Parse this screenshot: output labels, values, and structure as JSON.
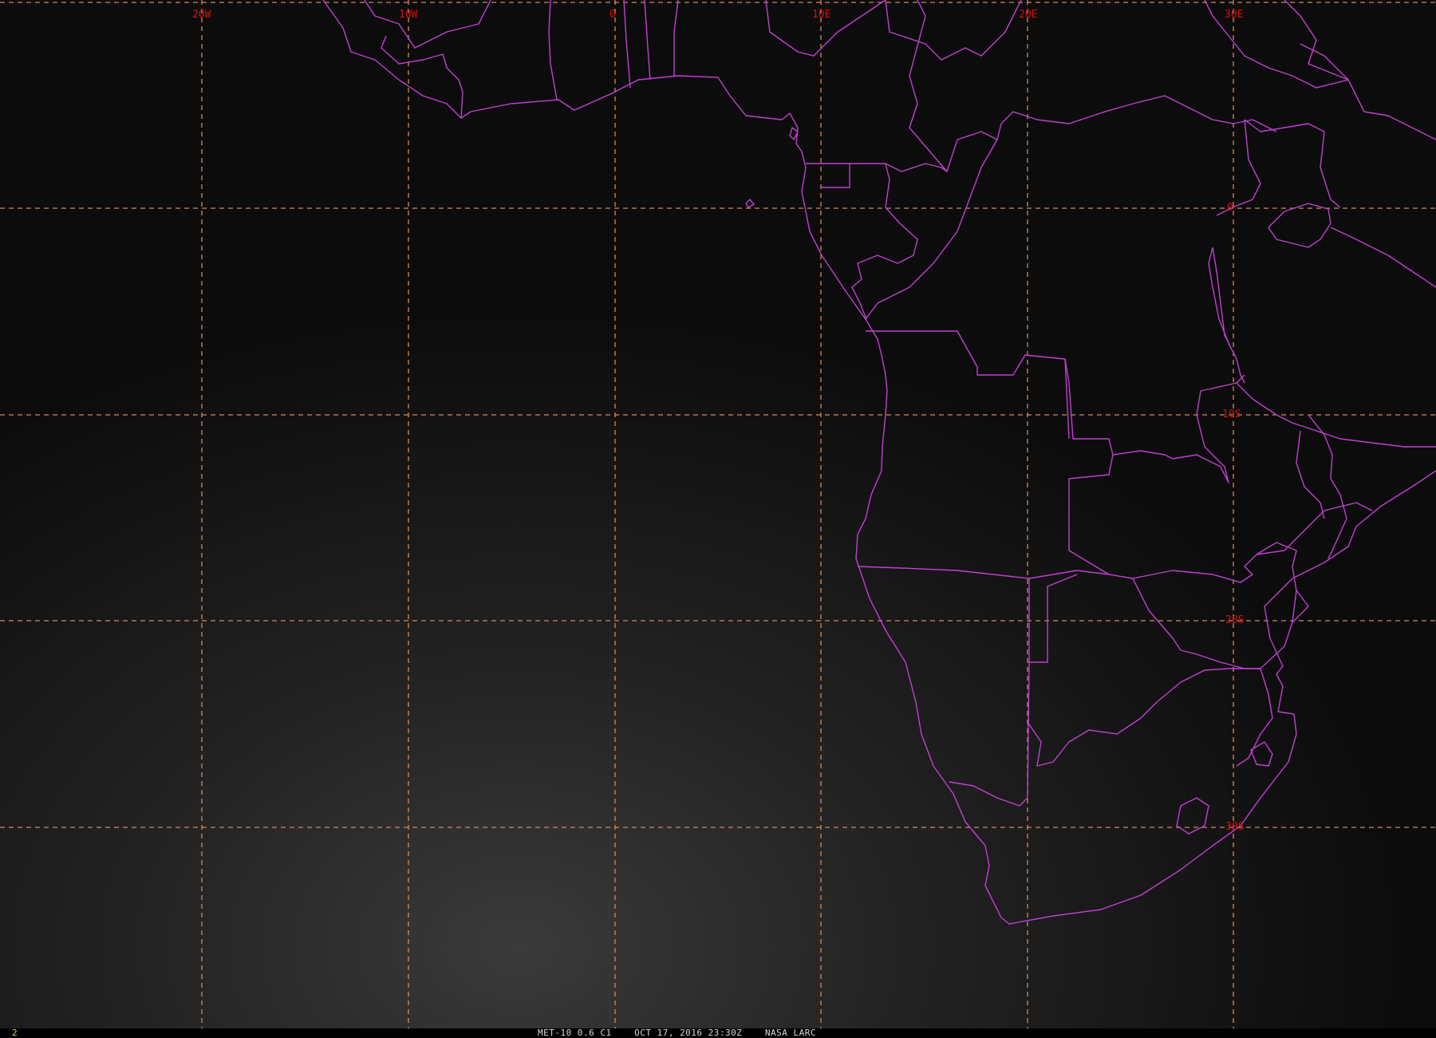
{
  "image": {
    "frame_number": "2",
    "caption": "MET-10 0.6 C1    OCT 17, 2016 23:30Z    NASA LARC"
  },
  "map": {
    "longitude_labels": [
      "20W",
      "10W",
      "0",
      "10E",
      "20E",
      "30E"
    ],
    "latitude_labels": [
      "0",
      "10S",
      "20S",
      "30S"
    ]
  },
  "colors": {
    "grid": "#d2895a",
    "boundaries": "#c040d0",
    "labels": "#d21010",
    "frame_number": "#e8d020"
  }
}
